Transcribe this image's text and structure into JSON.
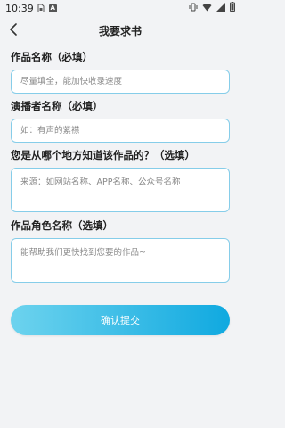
{
  "status_bar": {
    "time": "10:39",
    "notif_icon_a": "A"
  },
  "header": {
    "title": "我要求书"
  },
  "form": {
    "work_name": {
      "label": "作品名称（必填）",
      "placeholder": "尽量填全，能加快收录速度",
      "value": ""
    },
    "narrator": {
      "label": "演播者名称（必填）",
      "placeholder": "如：有声的紫襟",
      "value": ""
    },
    "source": {
      "label": "您是从哪个地方知道该作品的？（选填）",
      "placeholder": "来源：如网站名称、APP名称、公众号名称",
      "value": ""
    },
    "character": {
      "label": "作品角色名称（选填）",
      "placeholder": "能帮助我们更快找到您要的作品~",
      "value": ""
    }
  },
  "submit": {
    "label": "确认提交"
  },
  "colors": {
    "accent_start": "#6dd3ee",
    "accent_end": "#10a9e0",
    "input_border": "#86cde9",
    "background": "#f2f3f5"
  }
}
